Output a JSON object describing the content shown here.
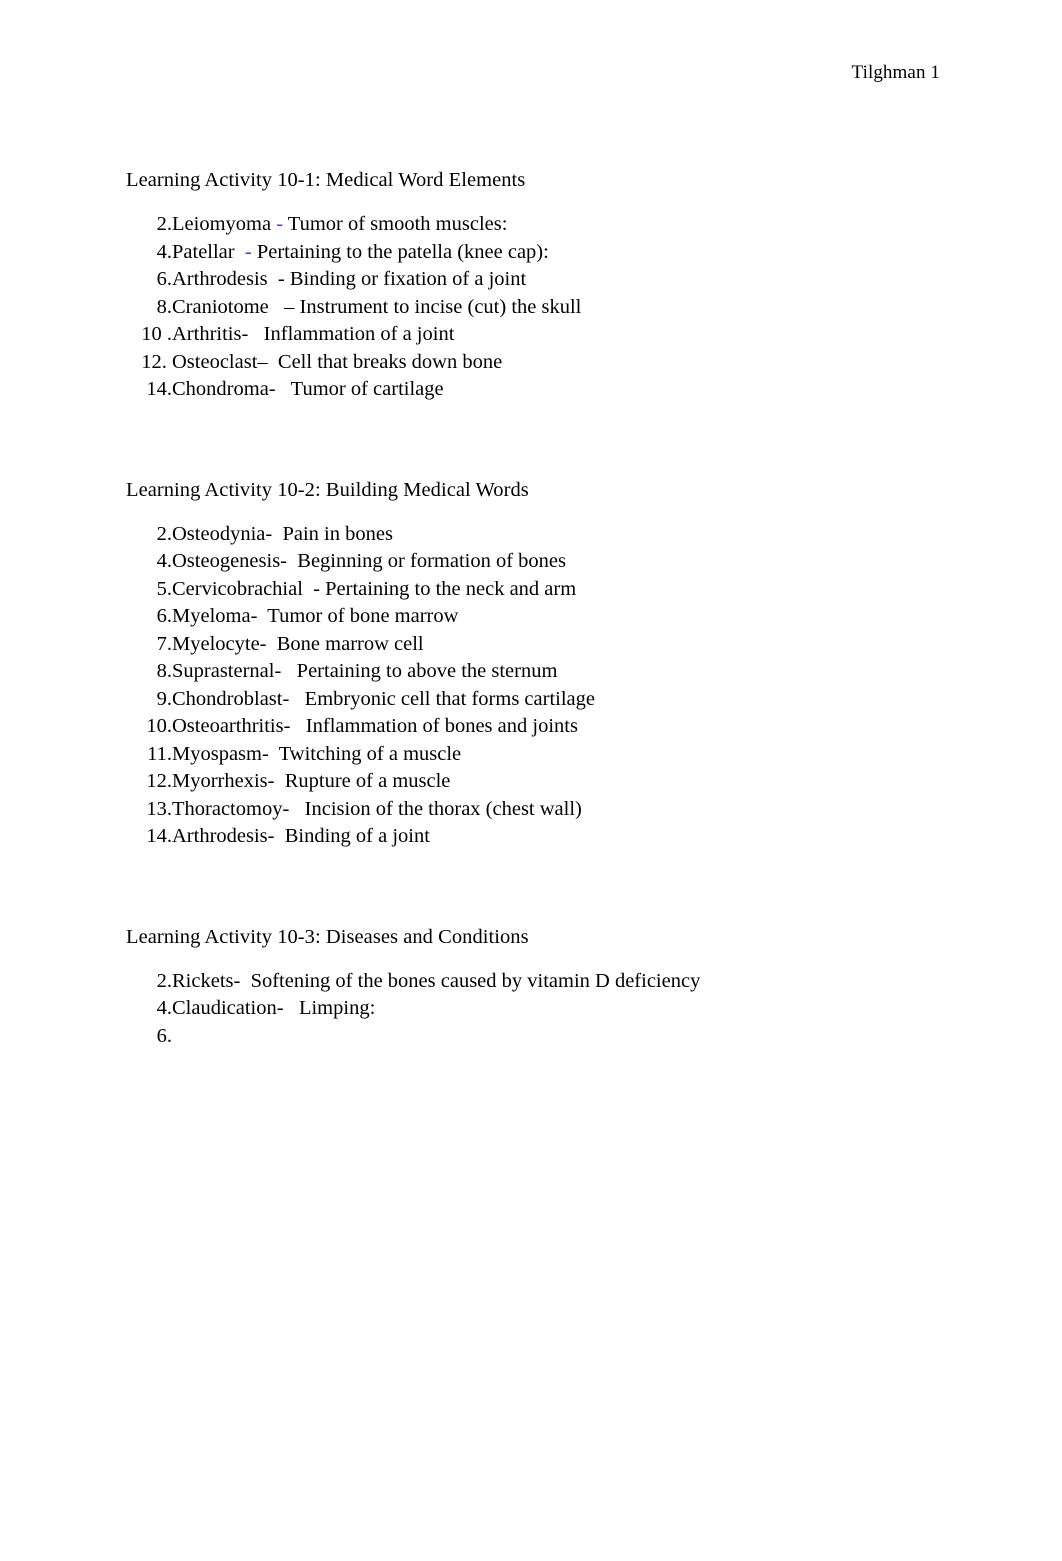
{
  "document": {
    "running_header": "Tilghman 1",
    "page_background": "#ffffff",
    "accent_dash_color": "#7030a0"
  },
  "sections": [
    {
      "heading": "Learning Activity 10-1: Medical Word Elements",
      "items": [
        {
          "num": "2.",
          "term": "Leiomyoma",
          "dash": " - ",
          "dash_accent": true,
          "definition": "Tumor of smooth muscles:"
        },
        {
          "num": "4.",
          "term": "Patellar",
          "dash": "  - ",
          "dash_accent": true,
          "definition": "Pertaining to the patella (knee cap):"
        },
        {
          "num": "6.",
          "term": "Arthrodesis",
          "dash": "  - ",
          "dash_accent": false,
          "definition": "Binding or fixation of a joint"
        },
        {
          "num": "8.",
          "term": "Craniotome",
          "dash": "   – ",
          "dash_accent": false,
          "definition": "Instrument to incise (cut) the skull"
        },
        {
          "num": "10 .",
          "term": "Arthritis-",
          "dash": "   ",
          "dash_accent": false,
          "definition": "Inflammation of a joint"
        },
        {
          "num": "12. ",
          "term": "Osteoclast–",
          "dash": "  ",
          "dash_accent": false,
          "definition": "Cell that breaks down bone"
        },
        {
          "num": "14.",
          "term": "Chondroma-",
          "dash": "   ",
          "dash_accent": false,
          "definition": "Tumor of cartilage"
        }
      ]
    },
    {
      "heading": "Learning Activity 10-2: Building Medical Words",
      "items": [
        {
          "num": "2.",
          "term": "Osteodynia-",
          "dash": "  ",
          "dash_accent": false,
          "definition": "Pain in bones"
        },
        {
          "num": "4.",
          "term": "Osteogenesis-",
          "dash": "  ",
          "dash_accent": false,
          "definition": "Beginning or formation of bones"
        },
        {
          "num": "5.",
          "term": "Cervicobrachial",
          "dash": "  - ",
          "dash_accent": false,
          "definition": "Pertaining to the neck and arm"
        },
        {
          "num": "6.",
          "term": "Myeloma-",
          "dash": "  ",
          "dash_accent": false,
          "definition": "Tumor of bone marrow"
        },
        {
          "num": "7.",
          "term": "Myelocyte-",
          "dash": "  ",
          "dash_accent": false,
          "definition": "Bone marrow cell"
        },
        {
          "num": "8.",
          "term": "Suprasternal-",
          "dash": "   ",
          "dash_accent": false,
          "definition": "Pertaining to above the sternum"
        },
        {
          "num": "9.",
          "term": "Chondroblast-",
          "dash": "   ",
          "dash_accent": false,
          "definition": "Embryonic cell that forms cartilage"
        },
        {
          "num": "10.",
          "term": "Osteoarthritis-",
          "dash": "   ",
          "dash_accent": false,
          "definition": "Inflammation of bones and joints"
        },
        {
          "num": "11.",
          "term": "Myospasm-",
          "dash": "  ",
          "dash_accent": false,
          "definition": "Twitching of a muscle"
        },
        {
          "num": "12.",
          "term": "Myorrhexis-",
          "dash": "  ",
          "dash_accent": false,
          "definition": "Rupture of a muscle"
        },
        {
          "num": "13.",
          "term": "Thoractomoy-",
          "dash": "   ",
          "dash_accent": false,
          "definition": "Incision of the thorax (chest wall)"
        },
        {
          "num": "14.",
          "term": "Arthrodesis-",
          "dash": "  ",
          "dash_accent": false,
          "definition": "Binding of a joint"
        }
      ]
    },
    {
      "heading": "Learning Activity 10-3: Diseases and Conditions",
      "items": [
        {
          "num": "2.",
          "term": "Rickets-",
          "dash": "  ",
          "dash_accent": false,
          "definition": "Softening of the bones caused by vitamin D deficiency"
        },
        {
          "num": "4.",
          "term": "Claudication-",
          "dash": "   ",
          "dash_accent": false,
          "definition": "Limping:"
        }
      ],
      "illegible_items": [
        {
          "num": "6.",
          "text": "",
          "blur_level": 1
        },
        {
          "num": "",
          "text": "",
          "blur_level": 2
        },
        {
          "num": "",
          "text": "",
          "blur_level": 3,
          "continuation": true
        },
        {
          "num": "",
          "text": "",
          "blur_level": 4
        },
        {
          "num": "",
          "text": "",
          "blur_level": 5
        },
        {
          "num": "",
          "text": "",
          "blur_level": 6
        },
        {
          "num": "",
          "text": "",
          "blur_level": 7
        },
        {
          "num": "",
          "text": "",
          "blur_level": 8
        }
      ]
    }
  ]
}
